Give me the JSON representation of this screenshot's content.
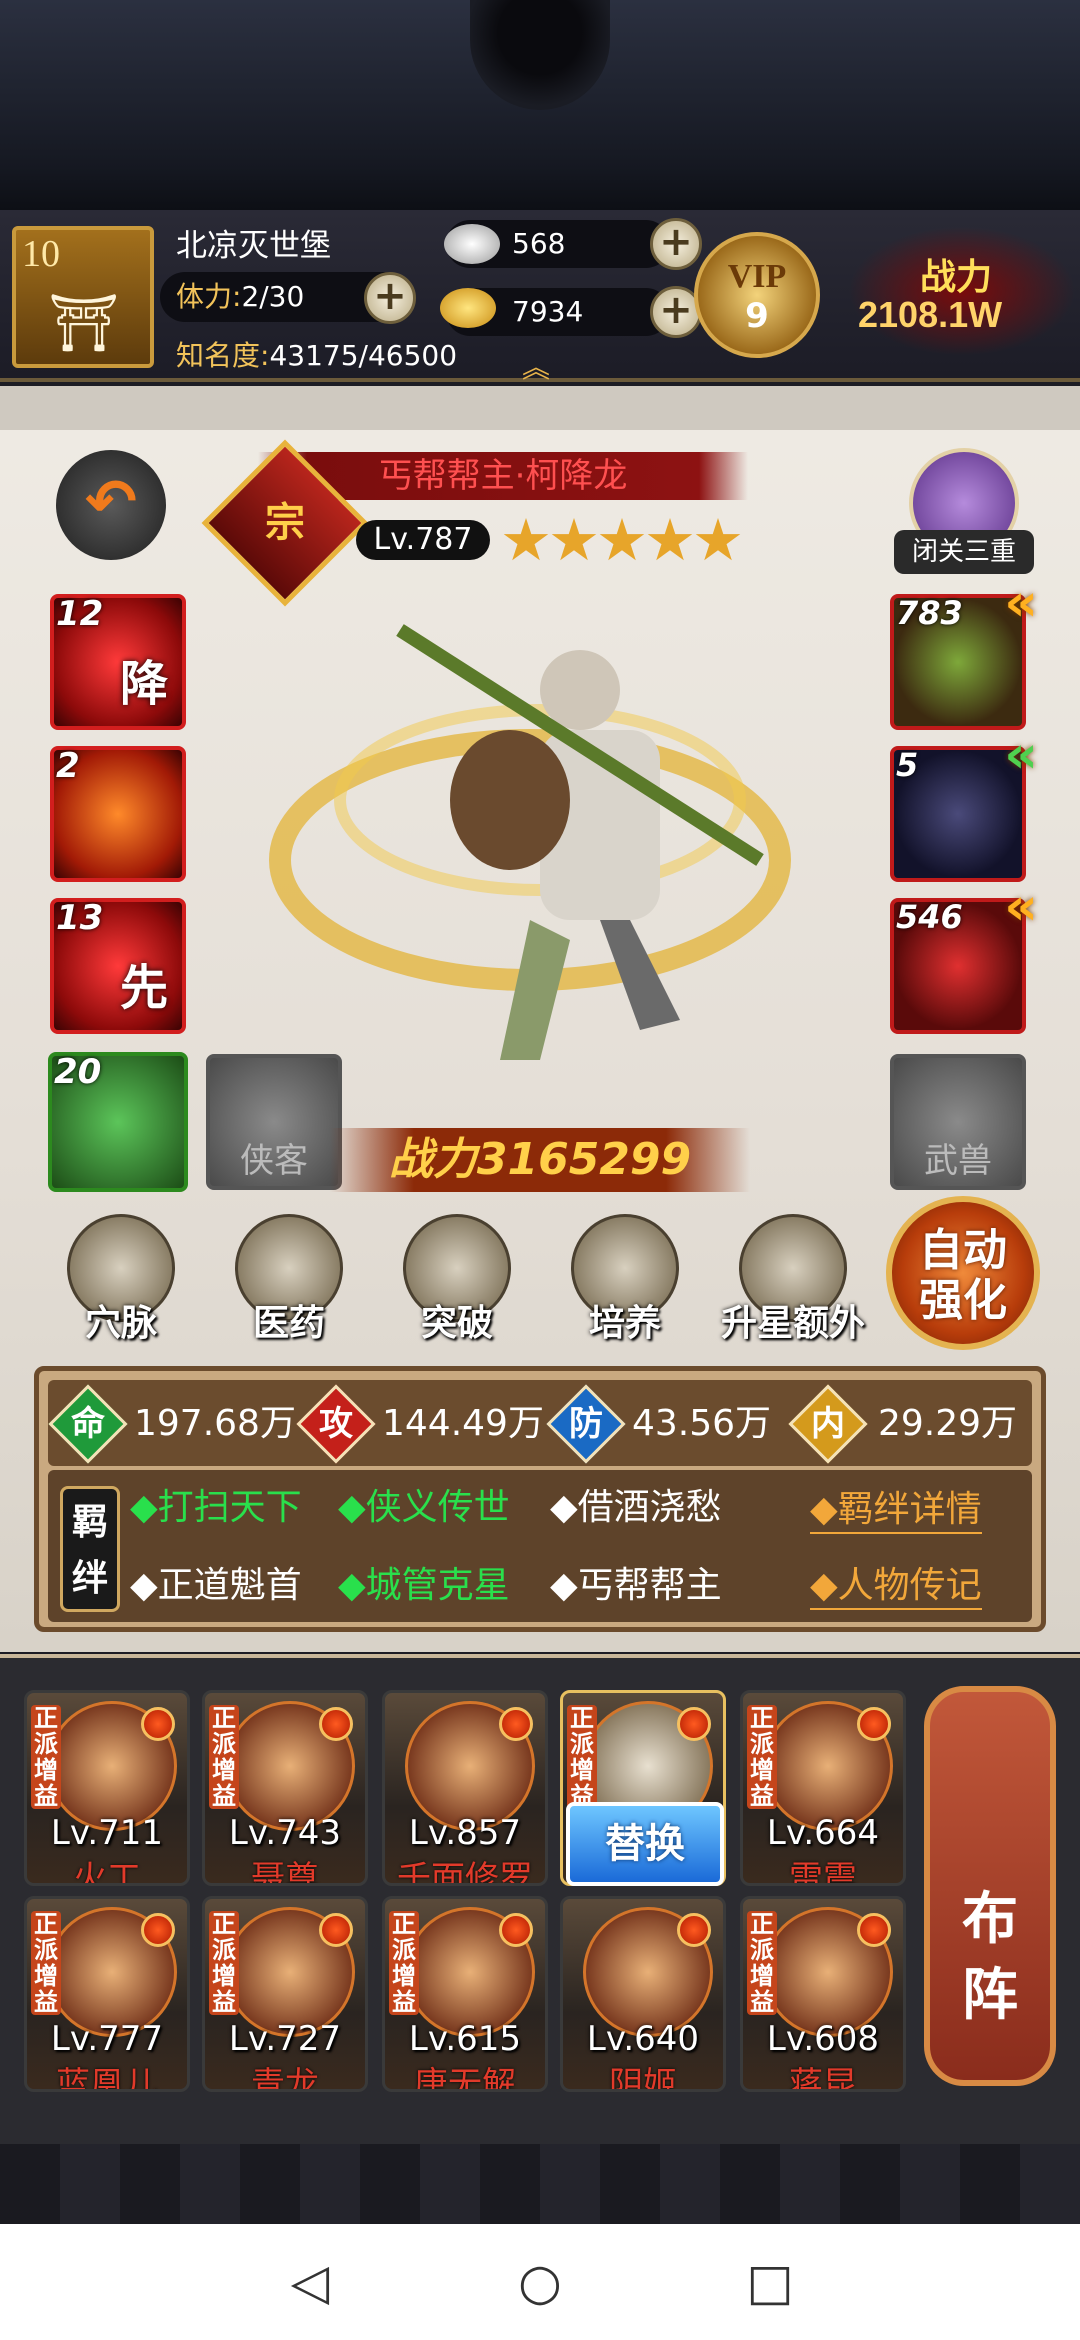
{
  "player": {
    "level": "10",
    "name": "北凉灭世堡",
    "stamina_label": "体力:",
    "stamina_value": "2/30",
    "fame_label": "知名度:",
    "fame_value": "43175/46500"
  },
  "currency": {
    "silver": "568",
    "gold": "7934"
  },
  "vip": {
    "label": "VIP",
    "level": "9"
  },
  "power_header": {
    "label": "战力",
    "value": "2108.1W"
  },
  "hero": {
    "title": "丐帮帮主·柯降龙",
    "badge": "宗",
    "level": "Lv.787",
    "stars": 5,
    "stars_text": "★★★★★",
    "power": "战力3165299"
  },
  "seclusion": {
    "label": "闭关三重"
  },
  "skills": [
    {
      "count": "12",
      "glyph": "降"
    },
    {
      "count": "2",
      "glyph": ""
    },
    {
      "count": "13",
      "glyph": "先"
    }
  ],
  "equipment": [
    {
      "count": "783"
    },
    {
      "count": "5"
    },
    {
      "count": "546"
    }
  ],
  "special_slot": {
    "count": "20"
  },
  "empty_slots": {
    "companion": "侠客",
    "beast": "武兽"
  },
  "menu": [
    {
      "label": "穴脉"
    },
    {
      "label": "医药"
    },
    {
      "label": "突破"
    },
    {
      "label": "培养"
    },
    {
      "label": "升星额外"
    }
  ],
  "auto_enhance": {
    "line1": "自动",
    "line2": "强化"
  },
  "stats": [
    {
      "icon": "命",
      "value": "197.68万",
      "color": "#1f9a3a"
    },
    {
      "icon": "攻",
      "value": "144.49万",
      "color": "#c4201a"
    },
    {
      "icon": "防",
      "value": "43.56万",
      "color": "#1a6ac4"
    },
    {
      "icon": "内",
      "value": "29.29万",
      "color": "#d49a1c"
    }
  ],
  "bonds": {
    "label": "羁绊",
    "items": [
      {
        "text": "◆打扫天下",
        "active": true
      },
      {
        "text": "◆侠义传世",
        "active": true
      },
      {
        "text": "◆借酒浇愁",
        "active": false
      },
      {
        "text": "◆正道魁首",
        "active": false
      },
      {
        "text": "◆城管克星",
        "active": true
      },
      {
        "text": "◆丐帮帮主",
        "active": false
      }
    ],
    "links": [
      "◆羁绊详情",
      "◆人物传记"
    ]
  },
  "lineup": [
    {
      "tag": "正派增益",
      "level": "Lv.711",
      "name": "火工"
    },
    {
      "tag": "正派增益",
      "level": "Lv.743",
      "name": "聂尊"
    },
    {
      "tag": "",
      "level": "Lv.857",
      "name": "千面修罗"
    },
    {
      "tag": "正派增益",
      "level": "",
      "name": ""
    },
    {
      "tag": "正派增益",
      "level": "Lv.664",
      "name": "雷震"
    },
    {
      "tag": "正派增益",
      "level": "Lv.777",
      "name": "蓝凰儿"
    },
    {
      "tag": "正派增益",
      "level": "Lv.727",
      "name": "青龙"
    },
    {
      "tag": "正派增益",
      "level": "Lv.615",
      "name": "唐无解"
    },
    {
      "tag": "",
      "level": "Lv.640",
      "name": "阴姬"
    },
    {
      "tag": "正派增益",
      "level": "Lv.608",
      "name": "蒋昆"
    }
  ],
  "replace_label": "替换",
  "formation": {
    "line1": "布",
    "line2": "阵"
  },
  "colors": {
    "gold": "#e7a52a",
    "bond_active": "#29e04c",
    "link": "#f2a73a"
  }
}
